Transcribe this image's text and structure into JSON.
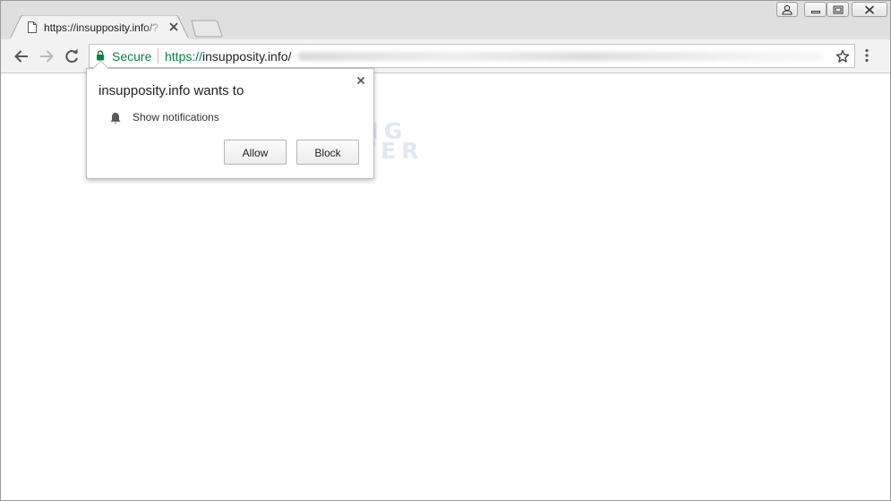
{
  "tab": {
    "title": "https://insupposity.info/?",
    "favicon": "page-icon",
    "close_icon": "close-icon"
  },
  "new_tab": {
    "icon": "new-tab-icon"
  },
  "window_controls": [
    "user-icon",
    "minimize-icon",
    "restore-icon",
    "close-icon"
  ],
  "toolbar": {
    "back_icon": "back-arrow-icon",
    "forward_icon": "forward-arrow-icon",
    "reload_icon": "reload-icon",
    "bookmark_icon": "star-icon",
    "menu_icon": "more-vert-icon"
  },
  "omnibox": {
    "secure_label": "Secure",
    "url_scheme": "https://",
    "url_host": "insupposity.info/"
  },
  "permission_bubble": {
    "heading": "insupposity.info wants to",
    "permission": "Show notifications",
    "allow_label": "Allow",
    "block_label": "Block"
  },
  "watermark": {
    "line1": "BLEEPING",
    "line2": "COMPUTER"
  },
  "colors": {
    "secure_green": "#0b8043",
    "toolbar_bg": "#f2f2f2",
    "tabstrip_bg": "#dfdfdf"
  }
}
